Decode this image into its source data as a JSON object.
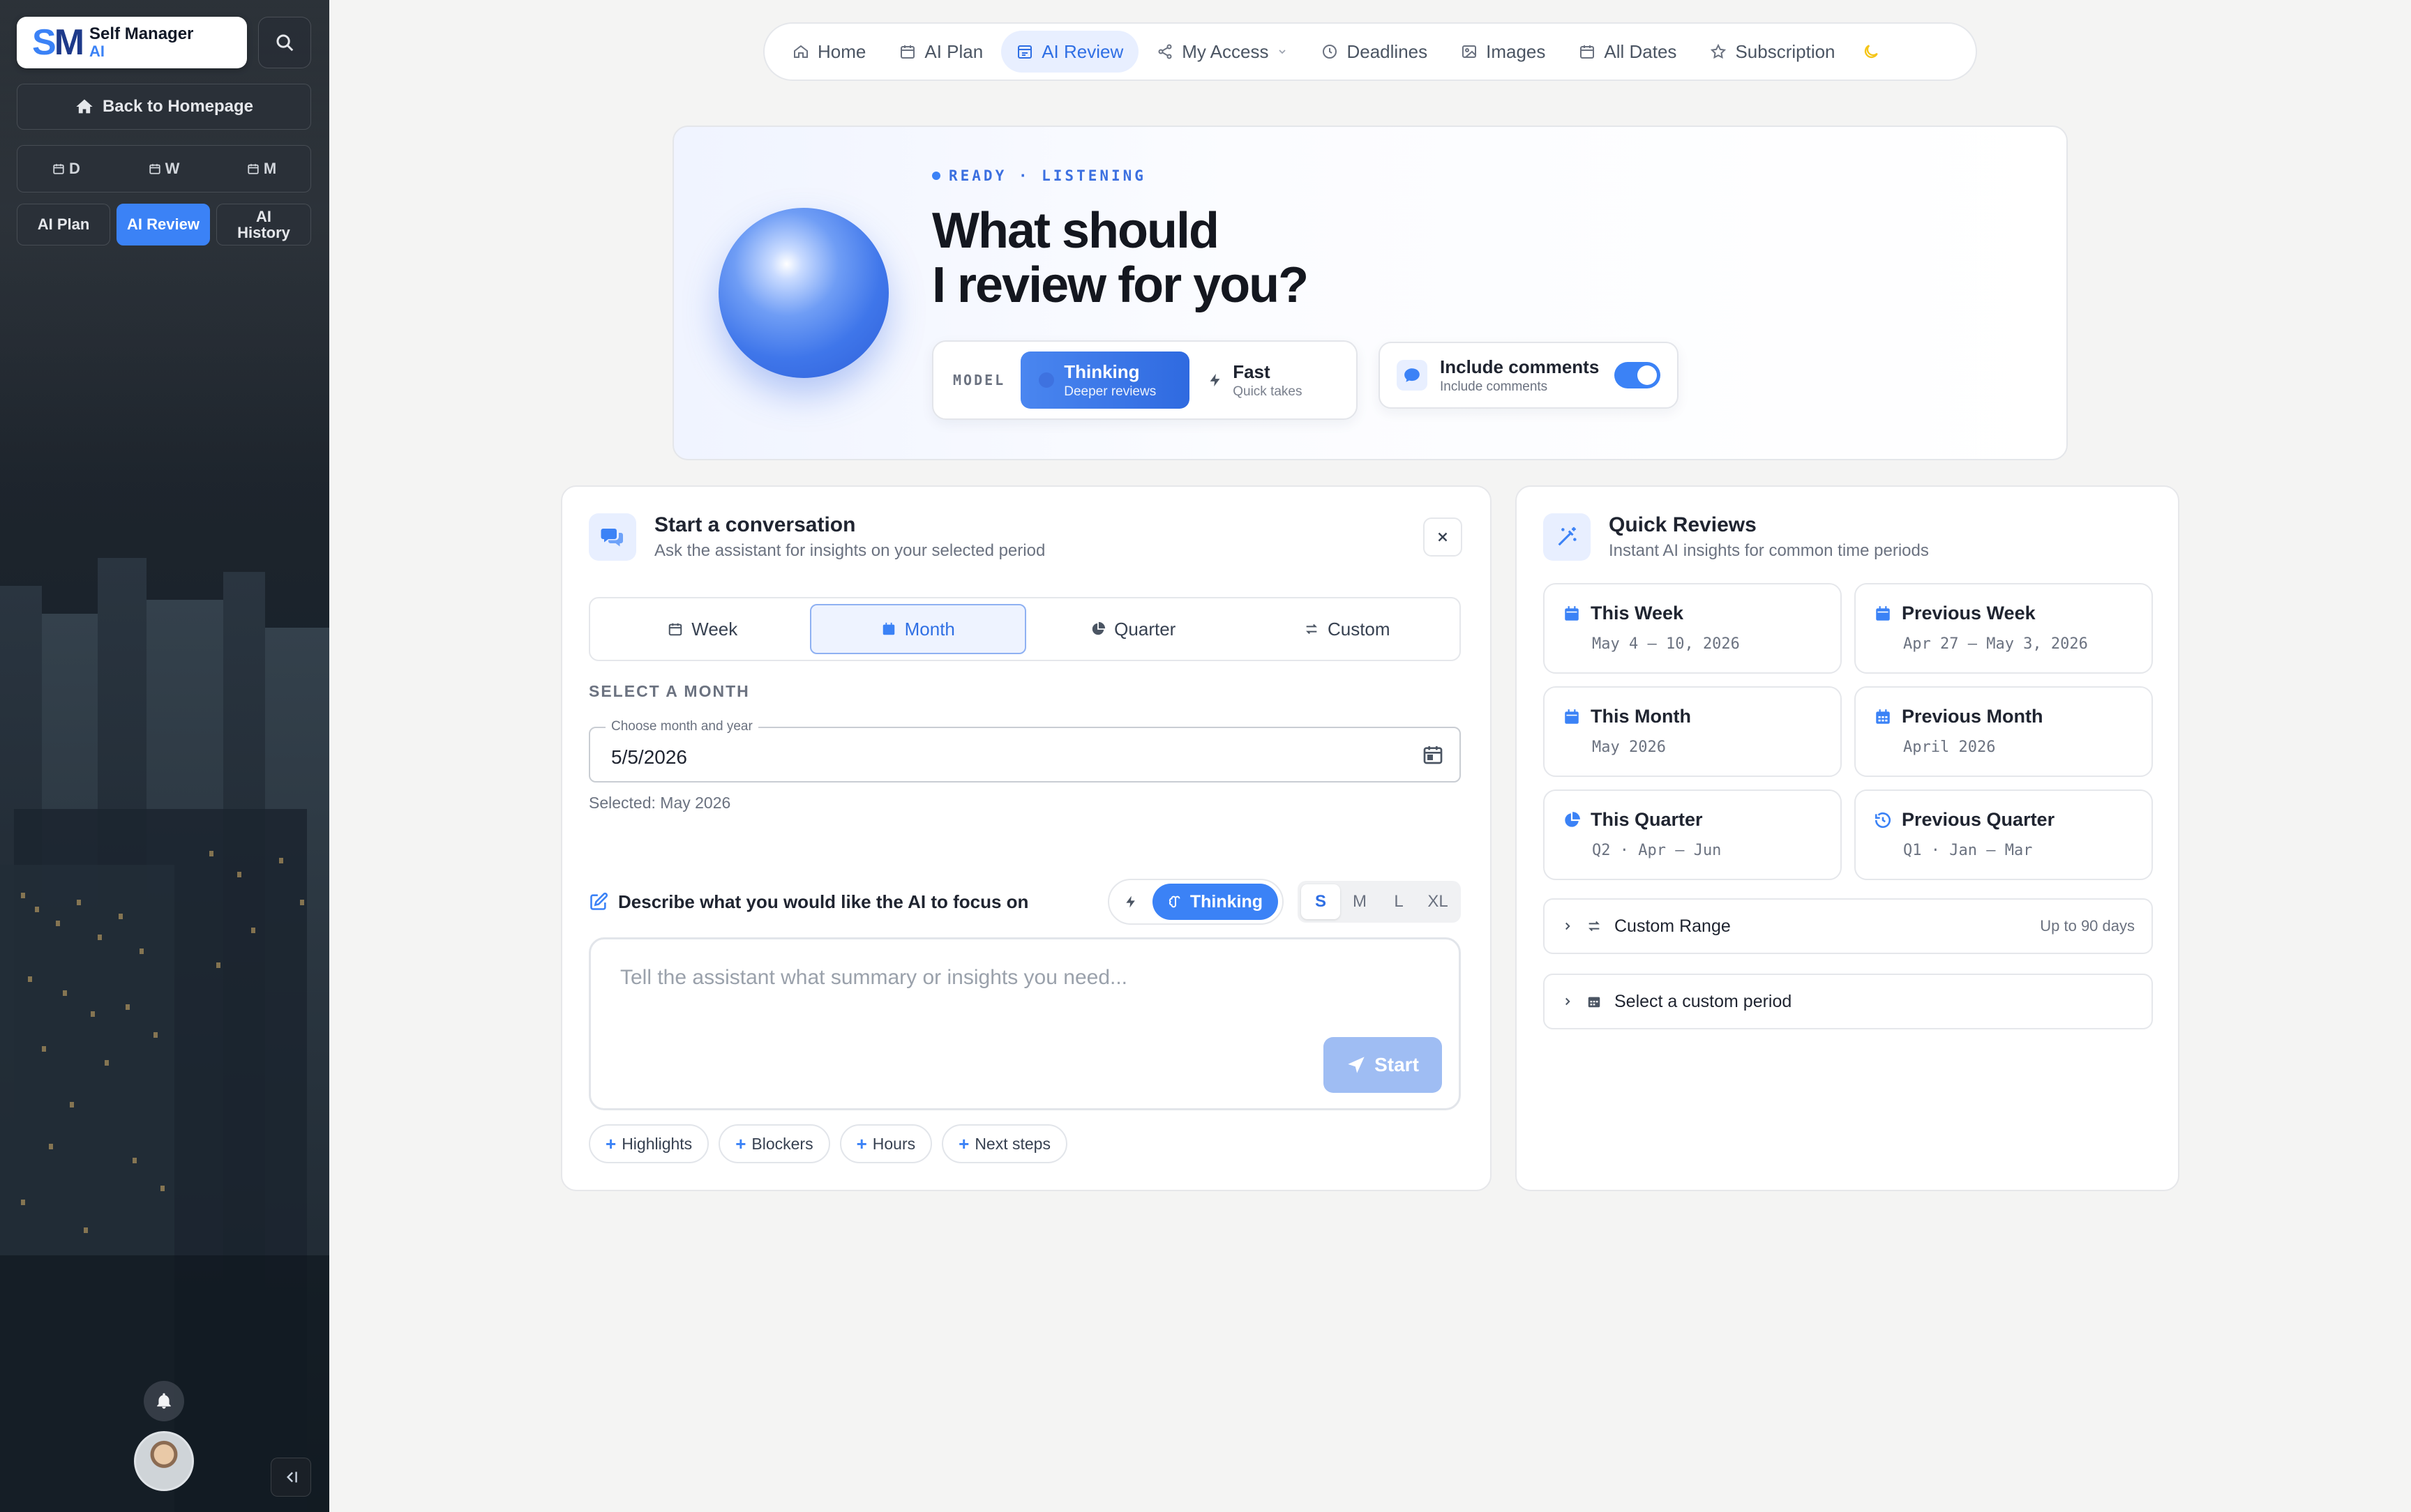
{
  "sidebar": {
    "logo": {
      "mark_s": "S",
      "mark_m": "M",
      "line1": "Self Manager",
      "line2": "AI"
    },
    "back_label": "Back to Homepage",
    "views": [
      {
        "label": "D"
      },
      {
        "label": "W"
      },
      {
        "label": "M"
      }
    ],
    "tabs": [
      {
        "label": "AI Plan",
        "active": false
      },
      {
        "label": "AI Review",
        "active": true
      },
      {
        "label": "AI History",
        "active": false
      }
    ]
  },
  "nav": {
    "items": [
      {
        "label": "Home",
        "icon": "home-icon"
      },
      {
        "label": "AI Plan",
        "icon": "calendar-icon"
      },
      {
        "label": "AI Review",
        "icon": "review-icon",
        "active": true
      },
      {
        "label": "My Access",
        "icon": "share-icon",
        "dropdown": true
      },
      {
        "label": "Deadlines",
        "icon": "clock-icon"
      },
      {
        "label": "Images",
        "icon": "image-icon"
      },
      {
        "label": "All Dates",
        "icon": "calendar-icon"
      },
      {
        "label": "Subscription",
        "icon": "star-icon"
      }
    ]
  },
  "hero": {
    "status": "READY · LISTENING",
    "title_line1": "What should",
    "title_line2": "I review for you?",
    "model_label": "MODEL",
    "model_options": [
      {
        "title": "Thinking",
        "sub": "Deeper reviews",
        "active": true
      },
      {
        "title": "Fast",
        "sub": "Quick takes",
        "active": false
      }
    ],
    "comments": {
      "title": "Include comments",
      "sub": "Include comments",
      "enabled": true
    }
  },
  "conversation": {
    "title": "Start a conversation",
    "subtitle": "Ask the assistant for insights on your selected period",
    "periods": [
      {
        "label": "Week"
      },
      {
        "label": "Month",
        "active": true
      },
      {
        "label": "Quarter"
      },
      {
        "label": "Custom"
      }
    ],
    "section_label": "SELECT A MONTH",
    "field_legend": "Choose month and year",
    "field_value": "5/5/2026",
    "selected_note": "Selected: May 2026",
    "focus_label": "Describe what you would like the AI to focus on",
    "mode_label": "Thinking",
    "sizes": [
      "S",
      "M",
      "L",
      "XL"
    ],
    "active_size": "S",
    "prompt_placeholder": "Tell the assistant what summary or insights you need...",
    "start_label": "Start",
    "chips": [
      "Highlights",
      "Blockers",
      "Hours",
      "Next steps"
    ]
  },
  "quick": {
    "title": "Quick Reviews",
    "subtitle": "Instant AI insights for common time periods",
    "items": [
      {
        "title": "This Week",
        "sub": "May 4 – 10, 2026",
        "icon": "calendar-icon"
      },
      {
        "title": "Previous Week",
        "sub": "Apr 27 – May 3, 2026",
        "icon": "calendar-icon"
      },
      {
        "title": "This Month",
        "sub": "May 2026",
        "icon": "calendar-icon"
      },
      {
        "title": "Previous Month",
        "sub": "April 2026",
        "icon": "calendar-grid-icon"
      },
      {
        "title": "This Quarter",
        "sub": "Q2 · Apr – Jun",
        "icon": "pie-icon"
      },
      {
        "title": "Previous Quarter",
        "sub": "Q1 · Jan – Mar",
        "icon": "history-icon"
      }
    ],
    "custom_range": {
      "label": "Custom Range",
      "hint": "Up to 90 days"
    },
    "custom_period": {
      "label": "Select a custom period"
    }
  },
  "colors": {
    "accent": "#3b82f6",
    "accent_dark": "#2f6fe4",
    "accent_soft": "#e8efff"
  }
}
